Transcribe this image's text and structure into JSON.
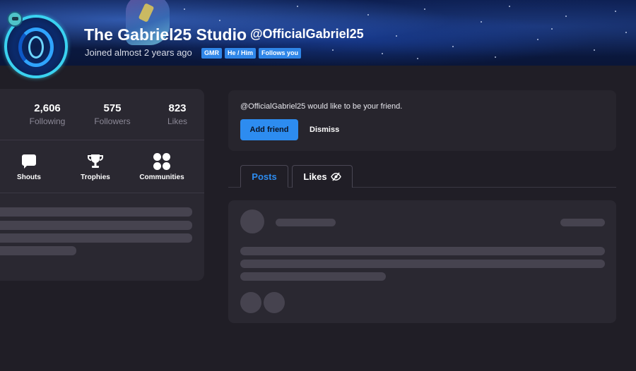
{
  "profile": {
    "display_name": "The Gabriel25 Studio",
    "handle": "@OfficialGabriel25",
    "joined": "Joined almost 2 years ago",
    "tags": [
      "GMR",
      "He / Him",
      "Follows you"
    ]
  },
  "stats": [
    {
      "value": "2,606",
      "label": "Following"
    },
    {
      "value": "575",
      "label": "Followers"
    },
    {
      "value": "823",
      "label": "Likes"
    }
  ],
  "actions": [
    {
      "label": "Shouts",
      "icon": "speech-bubble-icon"
    },
    {
      "label": "Trophies",
      "icon": "trophy-icon"
    },
    {
      "label": "Communities",
      "icon": "communities-icon"
    }
  ],
  "friend_request": {
    "message": "@OfficialGabriel25 would like to be your friend.",
    "accept_label": "Add friend",
    "dismiss_label": "Dismiss"
  },
  "tabs": [
    {
      "label": "Posts",
      "active": true
    },
    {
      "label": "Likes",
      "icon": "eye-slash-icon",
      "active": false
    }
  ],
  "colors": {
    "accent": "#2d8cf0",
    "background": "#201e26",
    "card": "#2a2831",
    "skeleton": "#46434f"
  }
}
